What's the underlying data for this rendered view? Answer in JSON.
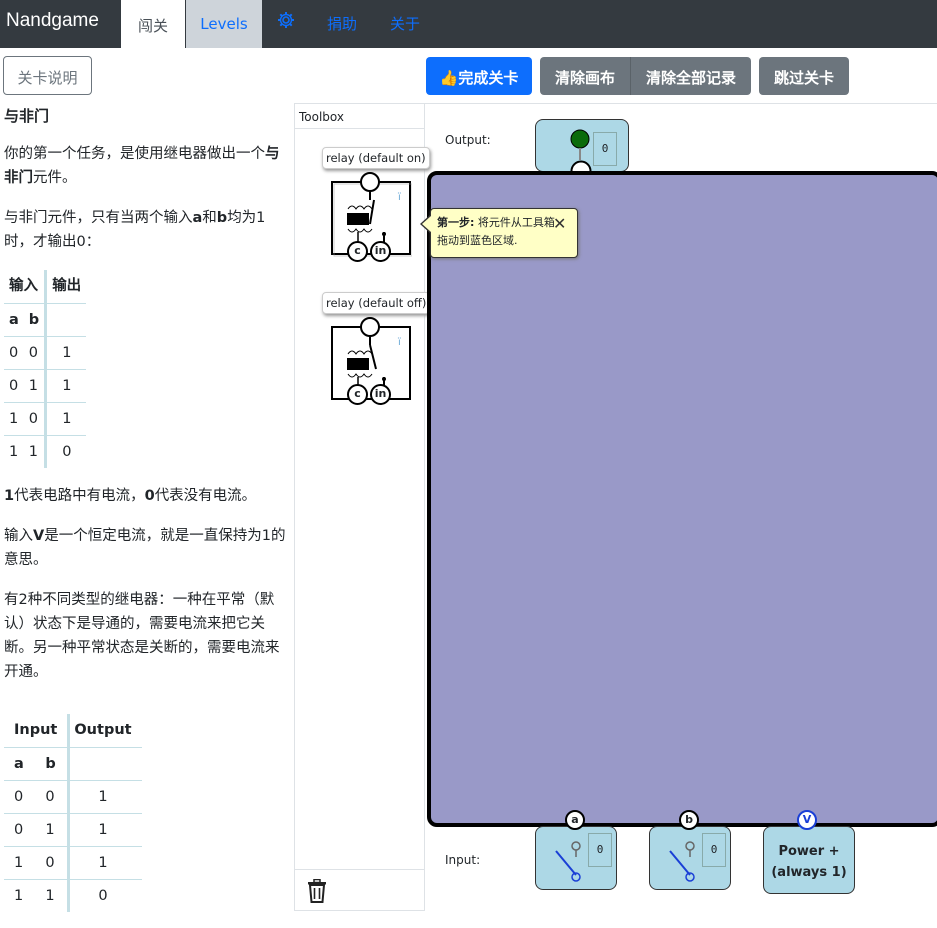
{
  "nav": {
    "brand": "Nandgame",
    "tab_active": "闯关",
    "tab_levels": "Levels",
    "donate": "捐助",
    "about": "关于"
  },
  "toolbar": {
    "help_button": "关卡说明",
    "complete": "完成关卡",
    "clear_canvas": "清除画布",
    "clear_all": "清除全部记录",
    "skip": "跳过关卡"
  },
  "left": {
    "title": "与非门",
    "p1_a": "你的第一个任务，是使用继电器做出一个",
    "p1_b": "与非门",
    "p1_c": "元件。",
    "p2_a": "与非门元件，只有当两个输入",
    "p2_b": "a",
    "p2_c": "和",
    "p2_d": "b",
    "p2_e": "均为1时，才输出0：",
    "table1": {
      "h_in": "输入",
      "h_out": "输出",
      "h_a": "a",
      "h_b": "b",
      "rows": [
        [
          "0",
          "0",
          "1"
        ],
        [
          "0",
          "1",
          "1"
        ],
        [
          "1",
          "0",
          "1"
        ],
        [
          "1",
          "1",
          "0"
        ]
      ]
    },
    "p3_a": "1",
    "p3_b": "代表电路中有电流，",
    "p3_c": "0",
    "p3_d": "代表没有电流。",
    "p4_a": "输入",
    "p4_b": "V",
    "p4_c": "是一个恒定电流，就是一直保持为1的意思。",
    "p5": "有2种不同类型的继电器：一种在平常（默认）状态下是导通的，需要电流来把它关断。另一种平常状态是关断的，需要电流来开通。",
    "table2": {
      "h_in": "Input",
      "h_out": "Output",
      "h_a": "a",
      "h_b": "b",
      "rows": [
        [
          "0",
          "0",
          "1"
        ],
        [
          "0",
          "1",
          "1"
        ],
        [
          "1",
          "0",
          "1"
        ],
        [
          "1",
          "1",
          "0"
        ]
      ]
    }
  },
  "toolbox": {
    "title": "Toolbox",
    "relay_on": "relay (default on)",
    "relay_off": "relay (default off)",
    "pin_c": "c",
    "pin_in": "in"
  },
  "canvas": {
    "output_label": "Output:",
    "input_label": "Input:",
    "output_value": "0",
    "in_a_label": "a",
    "in_a_value": "0",
    "in_b_label": "b",
    "in_b_value": "0",
    "power_pin": "V",
    "power_line1": "Power +",
    "power_line2": "(always 1)",
    "tip_bold": "第一步:",
    "tip_text": " 将元件从工具箱拖动到蓝色区域.",
    "tip_close": "✕"
  },
  "colors": {
    "board": "#9999c8",
    "node": "#add8e6",
    "navbar": "#343a40",
    "primary": "#0d6efd",
    "tooltip": "#ffffc6"
  }
}
